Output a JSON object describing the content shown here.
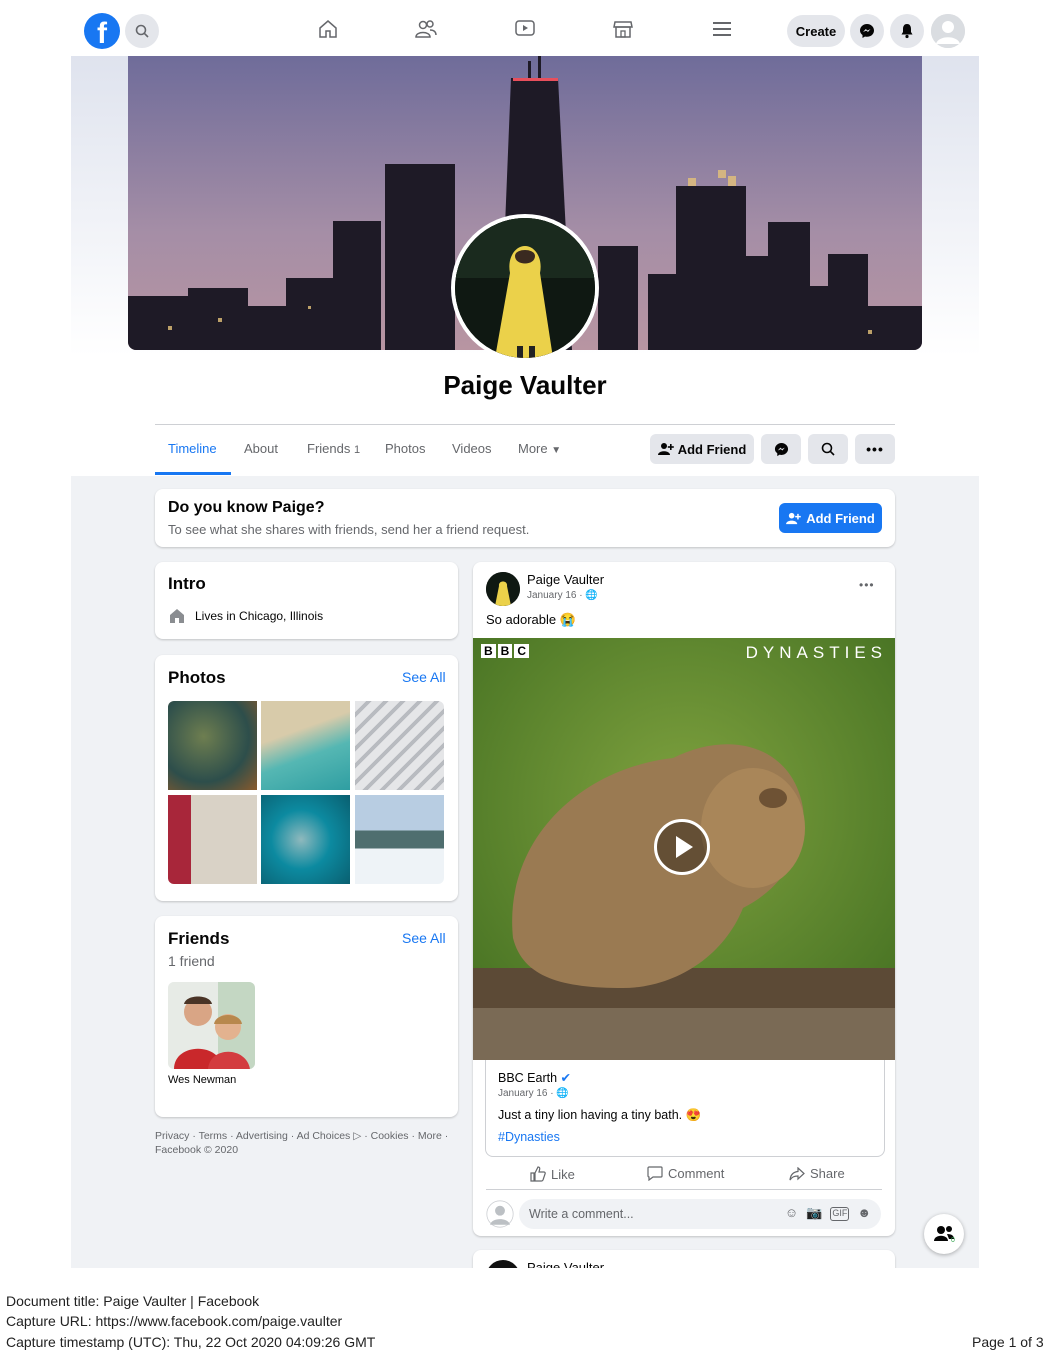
{
  "nav": {
    "create_label": "Create"
  },
  "profile": {
    "name": "Paige Vaulter"
  },
  "tabs": [
    {
      "label": "Timeline"
    },
    {
      "label": "About"
    },
    {
      "label": "Friends",
      "count": "1"
    },
    {
      "label": "Photos"
    },
    {
      "label": "Videos"
    },
    {
      "label": "More"
    }
  ],
  "actions": {
    "add_friend": "Add Friend"
  },
  "know": {
    "title": "Do you know Paige?",
    "subtitle": "To see what she shares with friends, send her a friend request.",
    "button": "Add Friend"
  },
  "intro": {
    "title": "Intro",
    "lives_prefix": "Lives in ",
    "city": "Chicago, Illinois"
  },
  "photos": {
    "title": "Photos",
    "see_all": "See All"
  },
  "friends": {
    "title": "Friends",
    "see_all": "See All",
    "count_text": "1 friend",
    "list": [
      {
        "name": "Wes Newman"
      }
    ]
  },
  "legal": {
    "line1": "Privacy · Terms · Advertising · Ad Choices ▷ · Cookies · More ·",
    "line2": "Facebook © 2020"
  },
  "post": {
    "author": "Paige Vaulter",
    "date": "January 16 ·",
    "text": "So adorable 😭",
    "video_brand": "BBC",
    "video_title": "DYNASTIES",
    "shared": {
      "author": "BBC Earth",
      "date": "January 16 ·",
      "text": "Just a tiny lion having a tiny bath. 😍",
      "hashtag": "#Dynasties"
    },
    "like": "Like",
    "comment": "Comment",
    "share": "Share",
    "comment_placeholder": "Write a comment..."
  },
  "next_post": {
    "author": "Paige Vaulter"
  },
  "chat": {
    "count": "0"
  },
  "doc": {
    "title_line": "Document title: Paige Vaulter | Facebook",
    "url_line": "Capture URL: https://www.facebook.com/paige.vaulter",
    "timestamp_line": "Capture timestamp (UTC): Thu, 22 Oct 2020 04:09:26 GMT",
    "page_line": "Page 1 of 3"
  },
  "colors": {
    "brand": "#1877f2",
    "background": "#f0f2f5"
  }
}
